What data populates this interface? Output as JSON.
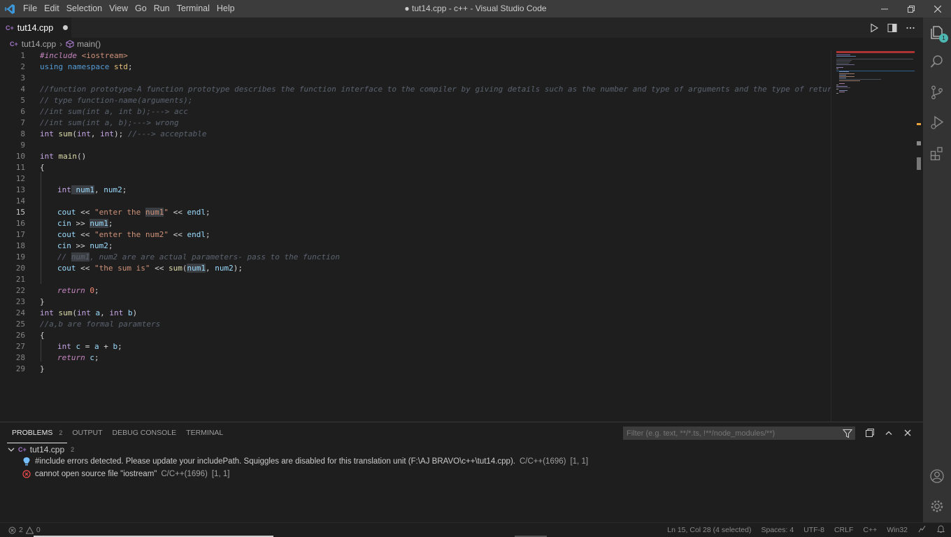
{
  "titlebar": {
    "menu": [
      "File",
      "Edit",
      "Selection",
      "View",
      "Go",
      "Run",
      "Terminal",
      "Help"
    ],
    "title": "● tut14.cpp - c++ - Visual Studio Code"
  },
  "tab": {
    "icon_text": "C+",
    "label": "tut14.cpp"
  },
  "breadcrumb": {
    "file": "tut14.cpp",
    "symbol": "main()"
  },
  "activity": {
    "explorer_badge": "1"
  },
  "code_lines": [
    {
      "n": "1"
    },
    {
      "n": "2"
    },
    {
      "n": "3"
    },
    {
      "n": "4"
    },
    {
      "n": "5"
    },
    {
      "n": "6"
    },
    {
      "n": "7"
    },
    {
      "n": "8"
    },
    {
      "n": "9"
    },
    {
      "n": "10"
    },
    {
      "n": "11"
    },
    {
      "n": "12"
    },
    {
      "n": "13"
    },
    {
      "n": "14"
    },
    {
      "n": "15"
    },
    {
      "n": "16"
    },
    {
      "n": "17"
    },
    {
      "n": "18"
    },
    {
      "n": "19"
    },
    {
      "n": "20"
    },
    {
      "n": "21"
    },
    {
      "n": "22"
    },
    {
      "n": "23"
    },
    {
      "n": "24"
    },
    {
      "n": "25"
    },
    {
      "n": "26"
    },
    {
      "n": "27"
    },
    {
      "n": "28"
    },
    {
      "n": "29"
    }
  ],
  "code": {
    "l1a": "#include",
    "l1b": " <iostream>",
    "l2a": "using",
    "l2b": " namespace",
    "l2c": " std",
    "l2d": ";",
    "l4": "//function prototype-A function prototype describes the function interface to the compiler by giving details such as the number and type of arguments and the type of return val",
    "l5": "// type function-name(arguments);",
    "l6": "//int sum(int a, int b);---> acc",
    "l7": "//int sum(int a, b);---> wrong",
    "l8a": "int",
    "l8b": " sum",
    "l8c": "(",
    "l8d": "int",
    "l8e": ", ",
    "l8f": "int",
    "l8g": "); ",
    "l8h": "//---> acceptable",
    "l10a": "int",
    "l10b": " main",
    "l10c": "()",
    "l11": "{",
    "l13a": "int",
    "l13b": " num1",
    "l13c": ", ",
    "l13d": "num2",
    "l13e": ";",
    "l15a": "cout",
    "l15b": " << ",
    "l15c": "\"enter the ",
    "l15d": "num1",
    "l15e": "\"",
    "l15f": " << ",
    "l15g": "endl",
    "l15h": ";",
    "l16a": "cin",
    "l16b": " >> ",
    "l16c": "num1",
    "l16d": ";",
    "l17a": "cout",
    "l17b": " << ",
    "l17c": "\"enter the num2\"",
    "l17d": " << ",
    "l17e": "endl",
    "l17f": ";",
    "l18a": "cin",
    "l18b": " >> ",
    "l18c": "num2",
    "l18d": ";",
    "l19a": "// ",
    "l19b": "num1",
    "l19c": ", num2 are are actual parameters- pass to the function",
    "l20a": "cout",
    "l20b": " << ",
    "l20c": "\"the sum is\"",
    "l20d": " << ",
    "l20e": "sum",
    "l20f": "(",
    "l20g": "num1",
    "l20h": ", ",
    "l20i": "num2",
    "l20j": ");",
    "l22a": "return",
    "l22b": " 0",
    "l22c": ";",
    "l23": "}",
    "l24a": "int",
    "l24b": " sum",
    "l24c": "(",
    "l24d": "int",
    "l24e": " a",
    "l24f": ", ",
    "l24g": "int",
    "l24h": " b",
    "l24i": ")",
    "l25": "//a,b are formal paramters",
    "l26": "{",
    "l27a": "int",
    "l27b": " c",
    "l27c": " = ",
    "l27d": "a",
    "l27e": " + ",
    "l27f": "b",
    "l27g": ";",
    "l28a": "return",
    "l28b": " c",
    "l28c": ";",
    "l29": "}"
  },
  "panel": {
    "tabs": [
      "PROBLEMS",
      "OUTPUT",
      "DEBUG CONSOLE",
      "TERMINAL"
    ],
    "problems_count": "2",
    "filter_placeholder": "Filter (e.g. text, **/*.ts, !**/node_modules/**)",
    "group_icon_text": "C+",
    "group_file": "tut14.cpp",
    "group_count": "2",
    "problems": [
      {
        "message": "#include errors detected. Please update your includePath. Squiggles are disabled for this translation unit (F:\\AJ BRAVO\\c++\\tut14.cpp).",
        "source": "C/C++(1696)",
        "pos": "[1, 1]",
        "severity": "info"
      },
      {
        "message": "cannot open source file \"iostream\"",
        "source": "C/C++(1696)",
        "pos": "[1, 1]",
        "severity": "error"
      }
    ]
  },
  "statusbar": {
    "errors": "2",
    "warnings": "0",
    "position": "Ln 15, Col 28 (4 selected)",
    "spaces": "Spaces: 4",
    "encoding": "UTF-8",
    "eol": "CRLF",
    "language": "C++",
    "platform": "Win32"
  },
  "colors": {
    "accent": "#007acc",
    "error": "#f14c4c",
    "info_bulb": "#75beff",
    "badge": "#4db6b0"
  }
}
